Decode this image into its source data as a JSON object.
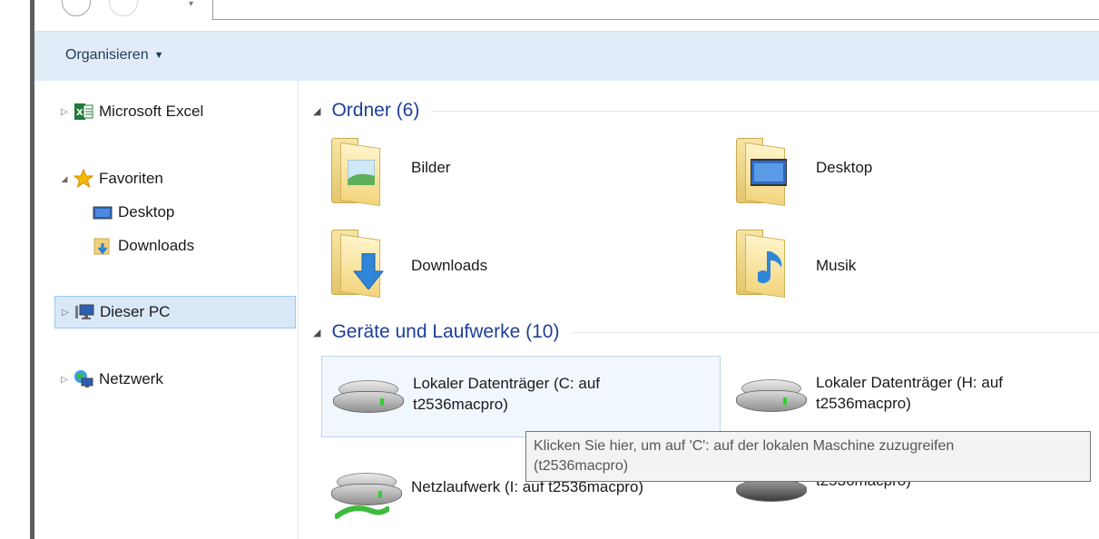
{
  "toolbar": {
    "organize_label": "Organisieren"
  },
  "nav": {
    "excel_label": "Microsoft Excel",
    "favorites_label": "Favoriten",
    "fav_desktop_label": "Desktop",
    "fav_downloads_label": "Downloads",
    "thispc_label": "Dieser PC",
    "network_label": "Netzwerk"
  },
  "groups": {
    "folders_header": "Ordner (6)",
    "drives_header": "Geräte und Laufwerke (10)"
  },
  "folders": [
    {
      "label": "Bilder"
    },
    {
      "label": "Desktop"
    },
    {
      "label": "Downloads"
    },
    {
      "label": "Musik"
    }
  ],
  "drives": [
    {
      "line1": "Lokaler Datenträger (C: auf",
      "line2": "t2536macpro)"
    },
    {
      "line1": "Lokaler Datenträger (H: auf",
      "line2": "t2536macpro)"
    },
    {
      "line1": "Netzlaufwerk (I: auf t2536macpro)"
    },
    {
      "line1": "",
      "line2": "t2536macpro)"
    }
  ],
  "tooltip": {
    "line1": "Klicken Sie hier, um auf 'C': auf der lokalen Maschine zuzugreifen",
    "line2": "(t2536macpro)"
  },
  "colors": {
    "header_blue": "#1e3f9a",
    "command_bar": "#e2ecf8",
    "selection": "#d9e8f7"
  },
  "icons": {
    "excel": "excel-icon",
    "favorites": "star-icon",
    "desktop": "desktop-icon",
    "downloads": "downloads-folder-icon",
    "thispc": "computer-icon",
    "network": "network-icon"
  }
}
